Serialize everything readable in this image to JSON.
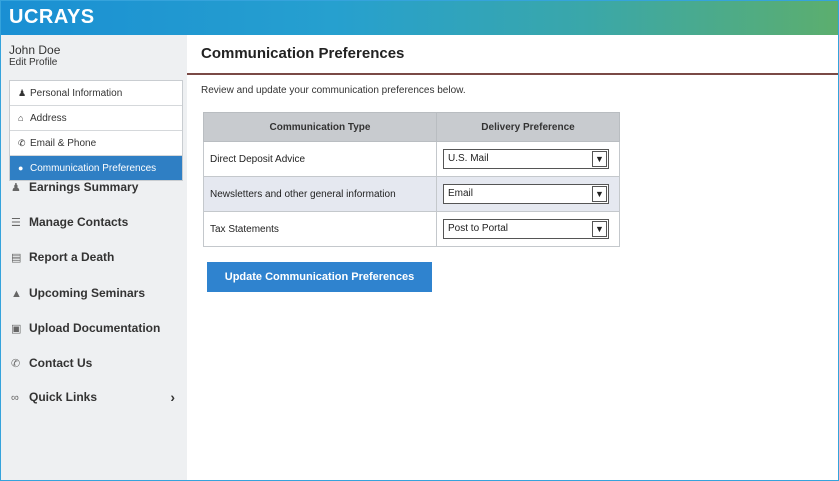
{
  "header": {
    "brand": "UCRAYS"
  },
  "sidebar": {
    "user_name": "John Doe",
    "edit_profile": "Edit Profile",
    "submenu": [
      {
        "label": "Personal Information",
        "icon": "user-icon"
      },
      {
        "label": "Address",
        "icon": "home-icon"
      },
      {
        "label": "Email & Phone",
        "icon": "phone-icon"
      },
      {
        "label": "Communication Preferences",
        "icon": "chat-icon",
        "active": true
      }
    ],
    "nav": [
      {
        "label": "Earnings Summary",
        "icon": "earnings-icon"
      },
      {
        "label": "Manage Contacts",
        "icon": "contacts-icon"
      },
      {
        "label": "Report a Death",
        "icon": "document-icon"
      },
      {
        "label": "Upcoming Seminars",
        "icon": "seminar-icon"
      },
      {
        "label": "Upload Documentation",
        "icon": "upload-icon"
      },
      {
        "label": "Contact Us",
        "icon": "phone-icon"
      },
      {
        "label": "Quick Links",
        "icon": "link-icon"
      }
    ]
  },
  "main": {
    "title": "Communication Preferences",
    "intro": "Review and update your communication preferences below.",
    "table": {
      "headers": [
        "Communication Type",
        "Delivery Preference"
      ],
      "rows": [
        {
          "type": "Direct Deposit Advice",
          "preference": "U.S. Mail"
        },
        {
          "type": "Newsletters and other general information",
          "preference": "Email"
        },
        {
          "type": "Tax Statements",
          "preference": "Post to Portal"
        }
      ]
    },
    "update_button": "Update Communication Preferences"
  },
  "colors": {
    "accent": "#2f83cf",
    "header_start": "#1a8fd3",
    "header_end": "#5cae6e",
    "title_rule": "#7a4a46"
  }
}
